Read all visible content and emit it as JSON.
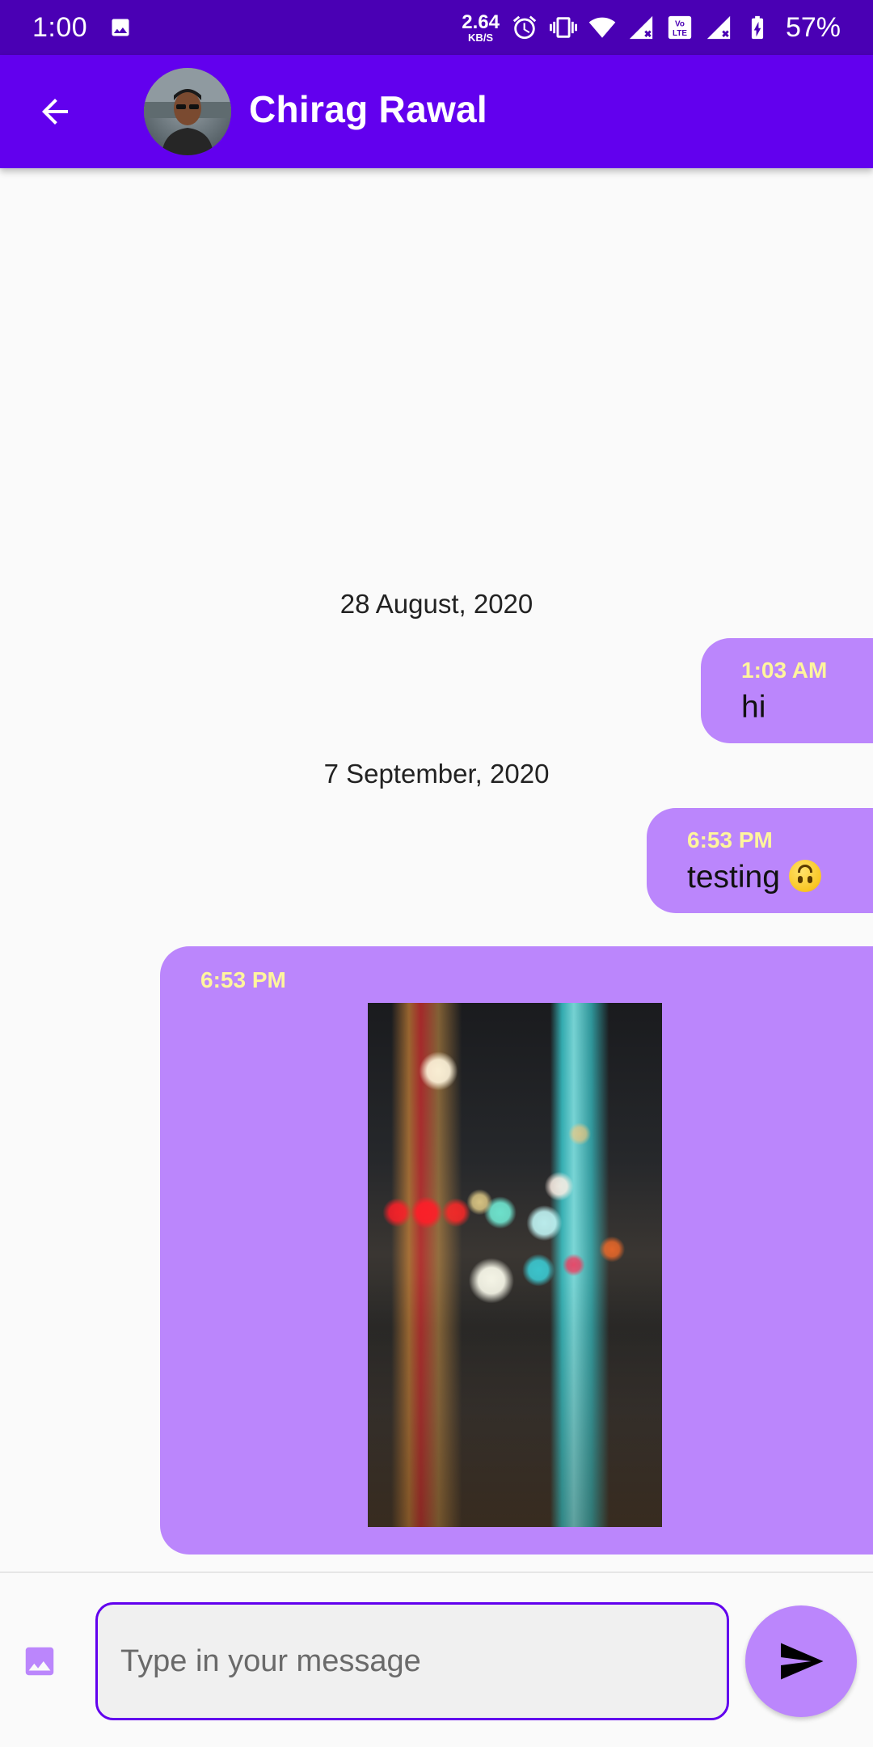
{
  "status_bar": {
    "time": "1:00",
    "net_speed_value": "2.64",
    "net_speed_unit": "KB/S",
    "battery": "57%",
    "icons": [
      "image-icon",
      "alarm-icon",
      "vibrate-icon",
      "wifi-icon",
      "signal-icon",
      "volte-icon",
      "signal-icon",
      "battery-charging-icon"
    ]
  },
  "header": {
    "back_icon": "arrow-back-icon",
    "contact_name": "Chirag Rawal"
  },
  "colors": {
    "status_bar": "#4a00b4",
    "app_bar": "#6200ee",
    "bubble": "#bb86fc",
    "timestamp": "#fff59d",
    "background": "#fafafa"
  },
  "messages": [
    {
      "date": "28 August, 2020"
    },
    {
      "time": "1:03 AM",
      "text": "hi"
    },
    {
      "date": "7 September, 2020"
    },
    {
      "time": "6:53 PM",
      "text": "testing",
      "emoji": "upside-down-face"
    },
    {
      "time": "6:53 PM",
      "type": "image"
    }
  ],
  "input": {
    "placeholder": "Type in your message",
    "value": "",
    "gallery_icon": "image-icon",
    "send_icon": "send-icon"
  }
}
